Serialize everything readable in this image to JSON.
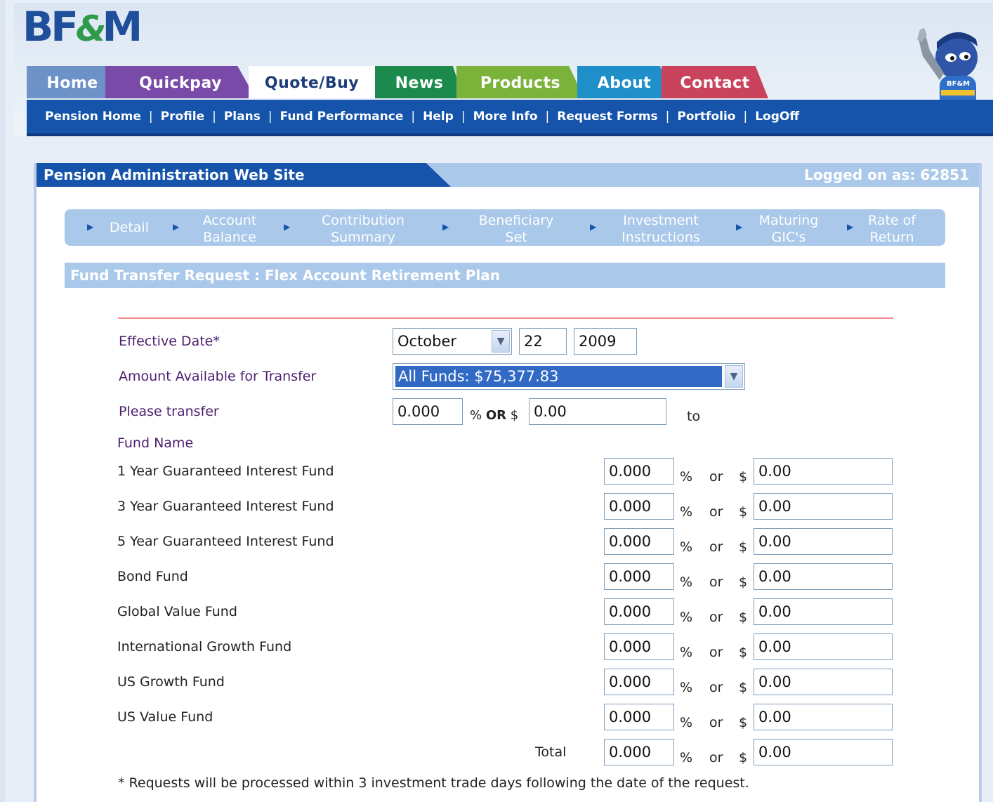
{
  "brand": {
    "logo_bf": "BF",
    "logo_amp": "&",
    "logo_m": "M",
    "mascot_badge": "BF&M"
  },
  "tabs": [
    {
      "label": "Home",
      "color": "#6d92c8"
    },
    {
      "label": "Quickpay",
      "color": "#7a4aa8"
    },
    {
      "label": "Quote/Buy",
      "color": "#ffffff"
    },
    {
      "label": "News",
      "color": "#1c8a4c"
    },
    {
      "label": "Products",
      "color": "#7bb33a"
    },
    {
      "label": "About",
      "color": "#1e8fc8"
    },
    {
      "label": "Contact",
      "color": "#c9435c"
    }
  ],
  "subnav": [
    "Pension Home",
    "Profile",
    "Plans",
    "Fund Performance",
    "Help",
    "More Info",
    "Request Forms",
    "Portfolio",
    "LogOff"
  ],
  "panel": {
    "title": "Pension Administration Web Site",
    "logged_on": "Logged on as: 62851"
  },
  "steps": [
    {
      "line1": "Detail",
      "line2": ""
    },
    {
      "line1": "Account",
      "line2": "Balance"
    },
    {
      "line1": "Contribution",
      "line2": "Summary"
    },
    {
      "line1": "Beneficiary",
      "line2": "Set"
    },
    {
      "line1": "Investment",
      "line2": "Instructions"
    },
    {
      "line1": "Maturing",
      "line2": "GIC's"
    },
    {
      "line1": "Rate of",
      "line2": "Return"
    }
  ],
  "form": {
    "title": "Fund Transfer Request : Flex Account Retirement Plan",
    "effective_date_label": "Effective Date*",
    "month": "October",
    "day": "22",
    "year": "2009",
    "amount_label": "Amount Available for Transfer",
    "amount_value": "All Funds: $75,377.83",
    "transfer_label": "Please transfer",
    "transfer_pct": "0.000",
    "pct_or": "%",
    "or_upper": "OR",
    "dollar": "$",
    "transfer_amt": "0.00",
    "to": "to",
    "fund_name_label": "Fund Name",
    "or_lower": "or",
    "funds": [
      {
        "name": "1 Year Guaranteed Interest Fund",
        "pct": "0.000",
        "amt": "0.00"
      },
      {
        "name": "3 Year Guaranteed Interest Fund",
        "pct": "0.000",
        "amt": "0.00"
      },
      {
        "name": "5 Year Guaranteed Interest Fund",
        "pct": "0.000",
        "amt": "0.00"
      },
      {
        "name": "Bond Fund",
        "pct": "0.000",
        "amt": "0.00"
      },
      {
        "name": "Global Value Fund",
        "pct": "0.000",
        "amt": "0.00"
      },
      {
        "name": "International Growth Fund",
        "pct": "0.000",
        "amt": "0.00"
      },
      {
        "name": "US Growth Fund",
        "pct": "0.000",
        "amt": "0.00"
      },
      {
        "name": "US Value Fund",
        "pct": "0.000",
        "amt": "0.00"
      }
    ],
    "total_label": "Total",
    "total_pct": "0.000",
    "total_amt": "0.00",
    "footnote": "* Requests will be processed within 3 investment trade days following the date of the request."
  }
}
